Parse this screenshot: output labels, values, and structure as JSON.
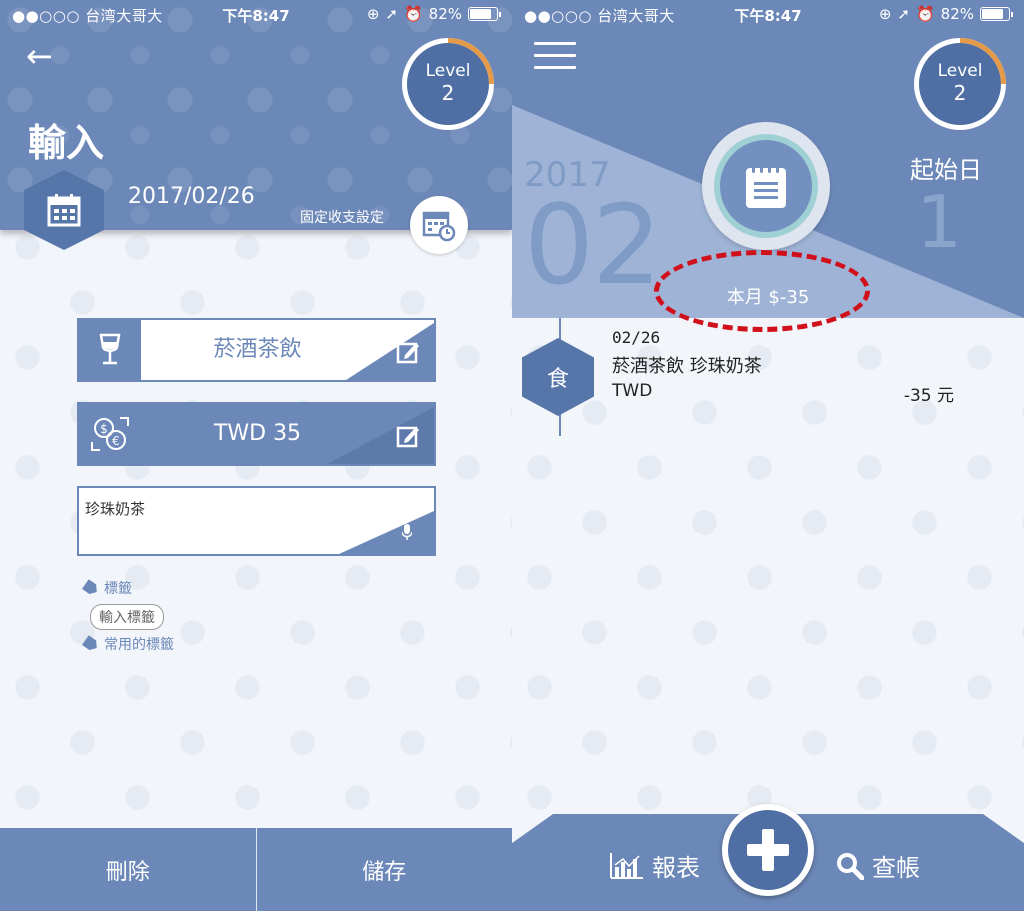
{
  "status": {
    "carrier": "●●○○○ 台湾大哥大",
    "time": "下午8:47",
    "battery": "82%",
    "battery_level": 0.82
  },
  "left": {
    "title": "輸入",
    "level_label": "Level",
    "level_value": "2",
    "level_progress": 0.25,
    "date": "2017/02/26",
    "fixed_label": "固定收支設定",
    "category": "菸酒茶飲",
    "amount": "TWD 35",
    "memo": "珍珠奶茶",
    "tags_label": "標籤",
    "tag_input_label": "輸入標籤",
    "common_tags_label": "常用的標籤",
    "delete_label": "刪除",
    "save_label": "儲存"
  },
  "right": {
    "level_label": "Level",
    "level_value": "2",
    "level_progress": 0.25,
    "year": "2017",
    "month": "02",
    "start_label": "起始日",
    "start_day": "1",
    "month_total": "本月 $-35",
    "transaction": {
      "badge": "食",
      "date": "02/26",
      "description": "菸酒茶飲 珍珠奶茶",
      "currency": "TWD",
      "amount": "-35 元"
    },
    "report_label": "報表",
    "lookup_label": "查帳"
  },
  "colors": {
    "primary": "#6c88b8",
    "dark": "#4f6ea3",
    "light": "#9eb3d5",
    "level_arc": "#e39b4a",
    "annotation": "#d0101a"
  }
}
